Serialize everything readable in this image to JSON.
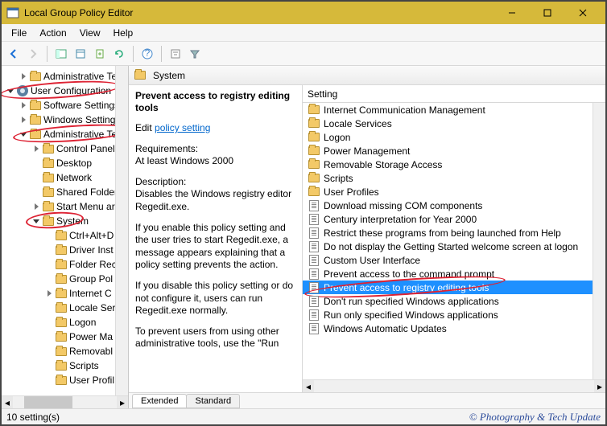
{
  "window": {
    "title": "Local Group Policy Editor"
  },
  "menu": [
    "File",
    "Action",
    "View",
    "Help"
  ],
  "tree": {
    "nodes": [
      {
        "depth": 1,
        "twist": "closed",
        "icon": "folder",
        "label": "Administrative Te"
      },
      {
        "depth": 0,
        "twist": "open",
        "icon": "cog",
        "label": "User Configuration",
        "circled": true
      },
      {
        "depth": 1,
        "twist": "closed",
        "icon": "folder",
        "label": "Software Settings"
      },
      {
        "depth": 1,
        "twist": "closed",
        "icon": "folder",
        "label": "Windows Setting"
      },
      {
        "depth": 1,
        "twist": "open",
        "icon": "folder",
        "label": "Administrative Te",
        "circled": true
      },
      {
        "depth": 2,
        "twist": "closed",
        "icon": "folder",
        "label": "Control Panel"
      },
      {
        "depth": 2,
        "twist": "",
        "icon": "folder",
        "label": "Desktop"
      },
      {
        "depth": 2,
        "twist": "",
        "icon": "folder",
        "label": "Network"
      },
      {
        "depth": 2,
        "twist": "",
        "icon": "folder",
        "label": "Shared Folder"
      },
      {
        "depth": 2,
        "twist": "closed",
        "icon": "folder",
        "label": "Start Menu ar"
      },
      {
        "depth": 2,
        "twist": "open",
        "icon": "folder",
        "label": "System",
        "circled": true
      },
      {
        "depth": 3,
        "twist": "",
        "icon": "folder",
        "label": "Ctrl+Alt+D"
      },
      {
        "depth": 3,
        "twist": "",
        "icon": "folder",
        "label": "Driver Inst"
      },
      {
        "depth": 3,
        "twist": "",
        "icon": "folder",
        "label": "Folder Rec"
      },
      {
        "depth": 3,
        "twist": "",
        "icon": "folder",
        "label": "Group Pol"
      },
      {
        "depth": 3,
        "twist": "closed",
        "icon": "folder",
        "label": "Internet C"
      },
      {
        "depth": 3,
        "twist": "",
        "icon": "folder",
        "label": "Locale Ser"
      },
      {
        "depth": 3,
        "twist": "",
        "icon": "folder",
        "label": "Logon"
      },
      {
        "depth": 3,
        "twist": "",
        "icon": "folder",
        "label": "Power Ma"
      },
      {
        "depth": 3,
        "twist": "",
        "icon": "folder",
        "label": "Removabl"
      },
      {
        "depth": 3,
        "twist": "",
        "icon": "folder",
        "label": "Scripts"
      },
      {
        "depth": 3,
        "twist": "",
        "icon": "folder",
        "label": "User Profil"
      }
    ]
  },
  "header": {
    "title": "System"
  },
  "desc": {
    "title": "Prevent access to registry editing tools",
    "edit_prefix": "Edit ",
    "edit_link": "policy setting ",
    "req_label": "Requirements:",
    "req_text": "At least Windows 2000",
    "desc_label": "Description:",
    "desc_text": "Disables the Windows registry editor Regedit.exe.",
    "para1": "If you enable this policy setting and the user tries to start Regedit.exe, a message appears explaining that a policy setting prevents the action.",
    "para2": "If you disable this policy setting or do not configure it, users can run Regedit.exe normally.",
    "para3": "To prevent users from using other administrative tools, use the \"Run"
  },
  "list": {
    "header": "Setting",
    "items": [
      {
        "icon": "folder",
        "label": "Internet Communication Management"
      },
      {
        "icon": "folder",
        "label": "Locale Services"
      },
      {
        "icon": "folder",
        "label": "Logon"
      },
      {
        "icon": "folder",
        "label": "Power Management"
      },
      {
        "icon": "folder",
        "label": "Removable Storage Access"
      },
      {
        "icon": "folder",
        "label": "Scripts"
      },
      {
        "icon": "folder",
        "label": "User Profiles"
      },
      {
        "icon": "doc",
        "label": "Download missing COM components"
      },
      {
        "icon": "doc",
        "label": "Century interpretation for Year 2000"
      },
      {
        "icon": "doc",
        "label": "Restrict these programs from being launched from Help"
      },
      {
        "icon": "doc",
        "label": "Do not display the Getting Started welcome screen at logon"
      },
      {
        "icon": "doc",
        "label": "Custom User Interface"
      },
      {
        "icon": "doc",
        "label": "Prevent access to the command prompt"
      },
      {
        "icon": "doc",
        "label": "Prevent access to registry editing tools",
        "selected": true,
        "circled": true
      },
      {
        "icon": "doc",
        "label": "Don't run specified Windows applications"
      },
      {
        "icon": "doc",
        "label": "Run only specified Windows applications"
      },
      {
        "icon": "doc",
        "label": "Windows Automatic Updates"
      }
    ]
  },
  "tabs": {
    "extended": "Extended",
    "standard": "Standard"
  },
  "status": {
    "left": "10 setting(s)",
    "right": "© Photography & Tech Update"
  }
}
